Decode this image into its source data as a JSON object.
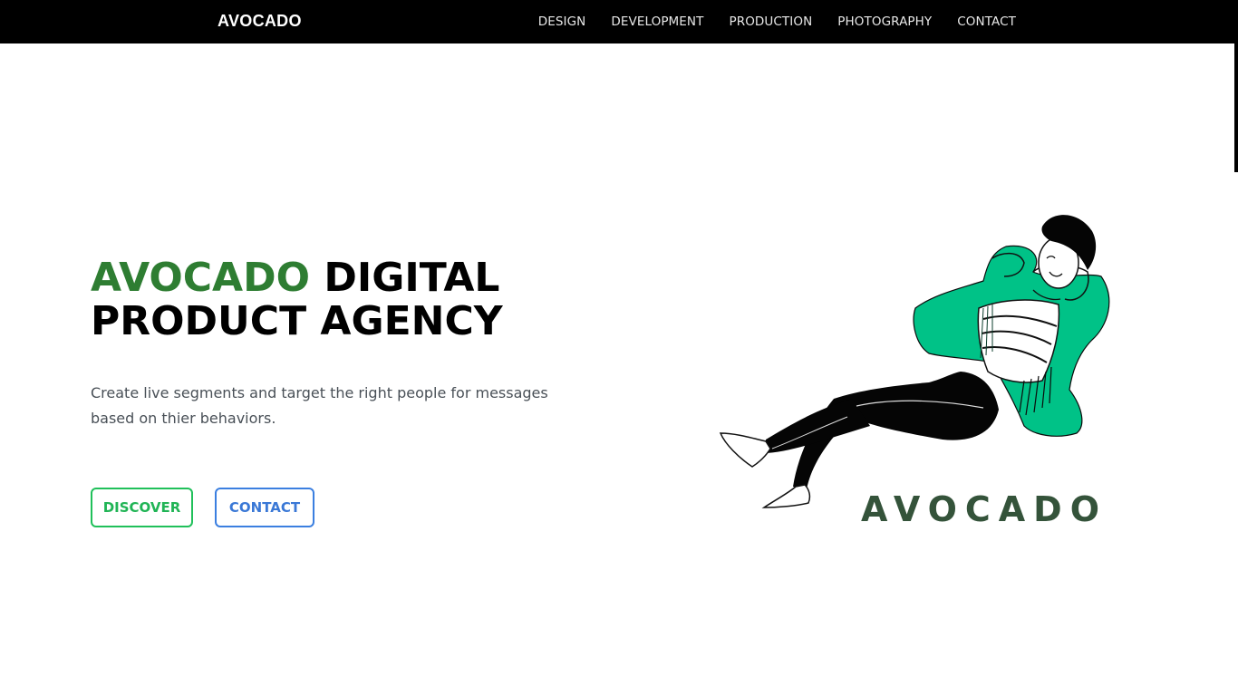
{
  "nav": {
    "brand": "AVOCADO",
    "links": [
      "DESIGN",
      "DEVELOPMENT",
      "PRODUCTION",
      "PHOTOGRAPHY",
      "CONTACT"
    ]
  },
  "hero": {
    "title_accent": "AVOCADO",
    "title_line1_rest": " DIGITAL",
    "title_line2": "PRODUCT AGENCY",
    "description": "Create live segments and target the right people for messages based on thier behaviors.",
    "buttons": {
      "discover": "DISCOVER",
      "contact": "CONTACT"
    }
  },
  "illustration": {
    "logo_text": "AVOCADO",
    "icon": "relaxing-person-illustration"
  },
  "colors": {
    "accent_green": "#2e7d32",
    "discover_green": "#20c05a",
    "contact_blue": "#3b7fe0",
    "jacket_green": "#00c287",
    "logo_green": "#34533a",
    "navbar": "#000000"
  }
}
